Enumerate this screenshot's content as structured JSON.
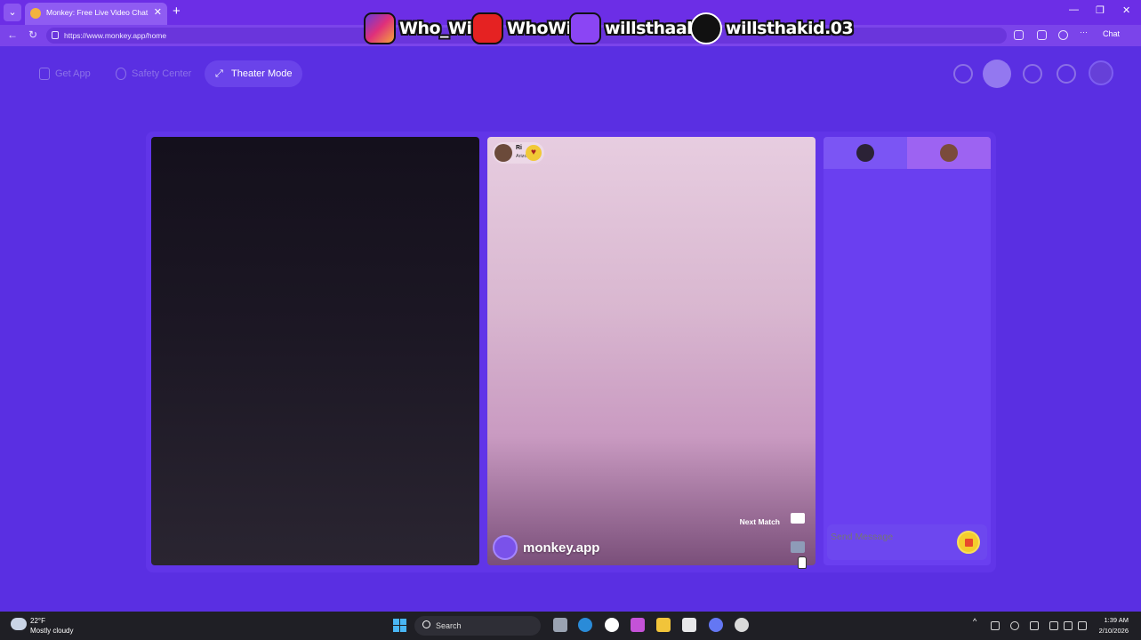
{
  "browser": {
    "tab_title": "Monkey: Free Live Video Chat",
    "url": "https://www.monkey.app/home",
    "chat_label": "Chat"
  },
  "overlay": {
    "instagram": "Who_Will",
    "youtube": "WhoWill",
    "twitch": "willsthaakid",
    "tiktok": "willsthakid.03"
  },
  "nav": {
    "get_app": "Get App",
    "safety_center": "Safety Center",
    "theater_mode": "Theater Mode"
  },
  "match": {
    "partner_name": "Ri",
    "partner_location": "Arizona",
    "brand": "monkey.app",
    "next_match": "Next Match"
  },
  "chat": {
    "placeholder": "Send Message"
  },
  "taskbar": {
    "temperature": "22°F",
    "condition": "Mostly cloudy",
    "search": "Search",
    "time": "1:39 AM",
    "date": "2/10/2026"
  }
}
